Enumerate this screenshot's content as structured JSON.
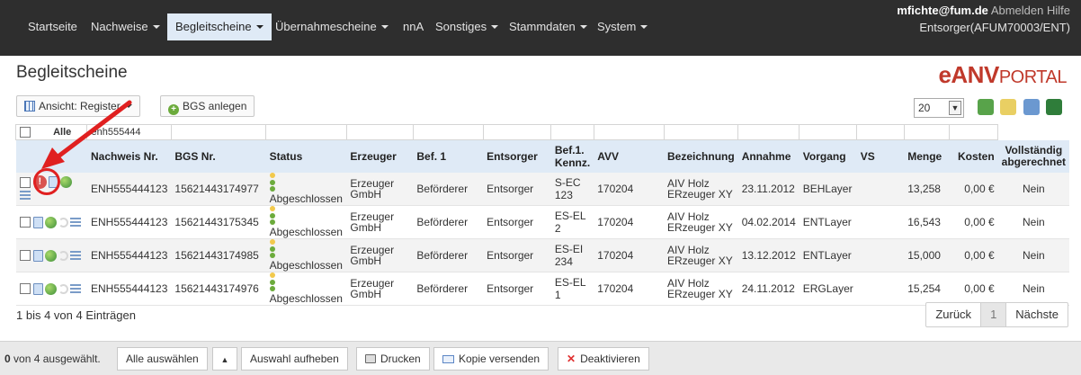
{
  "nav": {
    "items": [
      {
        "label": "Startseite",
        "caret": false
      },
      {
        "label": "Nachweise",
        "caret": true
      },
      {
        "label": "Begleitscheine",
        "caret": true
      },
      {
        "label": "Übernahmescheine",
        "caret": true
      },
      {
        "label": "nnA",
        "caret": false
      },
      {
        "label": "Sonstiges",
        "caret": true
      },
      {
        "label": "Stammdaten",
        "caret": true
      },
      {
        "label": "System",
        "caret": true
      }
    ],
    "user_email": "mfichte@fum.de",
    "logout": "Abmelden",
    "help": "Hilfe",
    "role": "Entsorger(AFUM70003/ENT)"
  },
  "page": {
    "title": "Begleitscheine",
    "brand_e": "e",
    "brand_anv": "ANV",
    "brand_portal": "PORTAL"
  },
  "toolbar": {
    "view_label": "Ansicht: Register",
    "create_label": "BGS anlegen",
    "page_size": "20"
  },
  "table": {
    "filter": {
      "alle": "Alle",
      "search": "enh555444"
    },
    "headers": [
      "Nachweis Nr.",
      "BGS Nr.",
      "Status",
      "Erzeuger",
      "Bef. 1",
      "Entsorger",
      "Bef.1. Kennz.",
      "AVV",
      "Bezeichnung",
      "Annahme",
      "Vorgang",
      "VS",
      "Menge",
      "Kosten",
      "Vollständig abgerechnet"
    ],
    "rows": [
      {
        "nachweis": "ENH555444123",
        "bgs": "15621443174977",
        "status": "Abgeschlossen",
        "erzeuger": "Erzeuger GmbH",
        "bef1": "Beförderer",
        "entsorger": "Entsorger",
        "kennz": "S-EC 123",
        "avv": "170204",
        "bez1": "AIV Holz",
        "bez2": "ERzeuger XY",
        "annahme": "23.11.2012",
        "vorgang": "BEHLayer",
        "vorgang_green": false,
        "vs": "",
        "menge": "13,258",
        "kosten": "0,00 €",
        "abgerechnet": "Nein"
      },
      {
        "nachweis": "ENH555444123",
        "bgs": "15621443175345",
        "status": "Abgeschlossen",
        "erzeuger": "Erzeuger GmbH",
        "bef1": "Beförderer",
        "entsorger": "Entsorger",
        "kennz": "ES-EL 2",
        "avv": "170204",
        "bez1": "AIV Holz",
        "bez2": "ERzeuger XY",
        "annahme": "04.02.2014",
        "vorgang": "ENTLayer",
        "vorgang_green": true,
        "vs": "",
        "menge": "16,543",
        "kosten": "0,00 €",
        "abgerechnet": "Nein"
      },
      {
        "nachweis": "ENH555444123",
        "bgs": "15621443174985",
        "status": "Abgeschlossen",
        "erzeuger": "Erzeuger GmbH",
        "bef1": "Beförderer",
        "entsorger": "Entsorger",
        "kennz": "ES-EI 234",
        "avv": "170204",
        "bez1": "AIV Holz",
        "bez2": "ERzeuger XY",
        "annahme": "13.12.2012",
        "vorgang": "ENTLayer",
        "vorgang_green": true,
        "vs": "",
        "menge": "15,000",
        "kosten": "0,00 €",
        "abgerechnet": "Nein"
      },
      {
        "nachweis": "ENH555444123",
        "bgs": "15621443174976",
        "status": "Abgeschlossen",
        "erzeuger": "Erzeuger GmbH",
        "bef1": "Beförderer",
        "entsorger": "Entsorger",
        "kennz": "ES-EL 1",
        "avv": "170204",
        "bez1": "AIV Holz",
        "bez2": "ERzeuger XY",
        "annahme": "24.11.2012",
        "vorgang": "ERGLayer",
        "vorgang_green": true,
        "vs": "",
        "menge": "15,254",
        "kosten": "0,00 €",
        "abgerechnet": "Nein"
      }
    ]
  },
  "footer": {
    "info": "1 bis 4 von 4 Einträgen",
    "prev": "Zurück",
    "page": "1",
    "next": "Nächste"
  },
  "bottombar": {
    "selected_count": "0",
    "selected_text": "von 4 ausgewählt.",
    "select_all": "Alle auswählen",
    "clear": "Auswahl aufheben",
    "print": "Drucken",
    "send_copy": "Kopie versenden",
    "deactivate": "Deaktivieren"
  },
  "colors": {
    "navbar": "#2e2e2e",
    "header_row": "#dfeaf6",
    "brand": "#c0392b",
    "vorgang_green": "#2b9a2b",
    "alert": "#d9534f"
  }
}
